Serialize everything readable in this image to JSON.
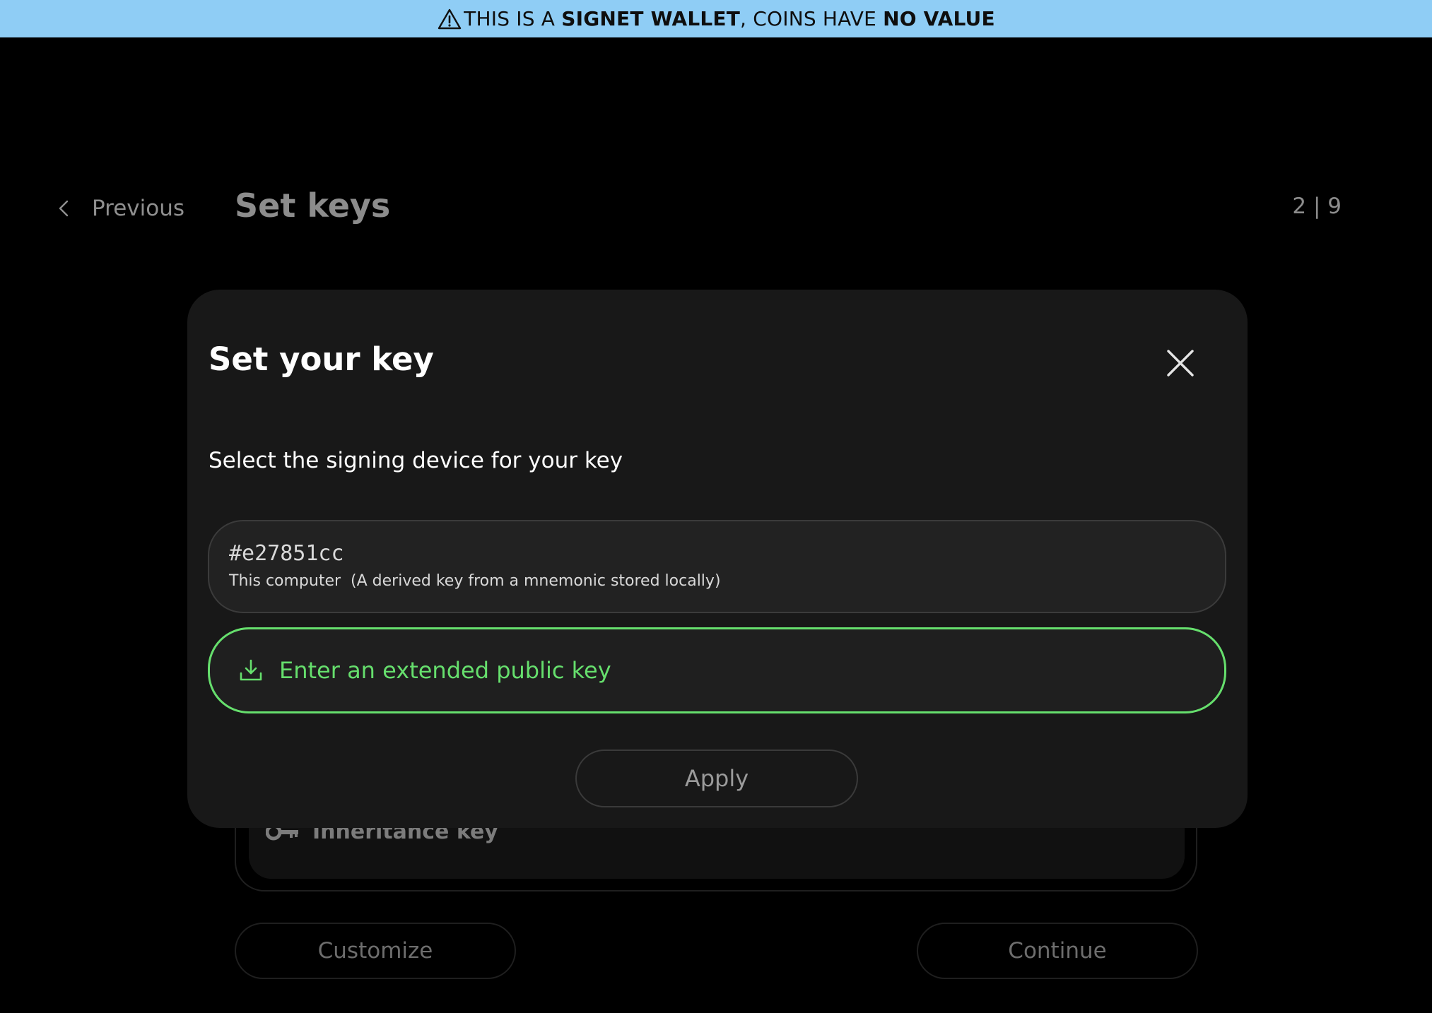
{
  "banner": {
    "prefix": "THIS IS A ",
    "wallet_type": "SIGNET WALLET",
    "middle": ", COINS HAVE ",
    "value_text": "NO VALUE",
    "icon": "warning-triangle-icon",
    "background_color": "#8fcdf5"
  },
  "header": {
    "previous_label": "Previous",
    "title": "Set keys",
    "step": "2 | 9"
  },
  "background": {
    "inheritance_key_label": "Inheritance key",
    "customize_label": "Customize",
    "continue_label": "Continue"
  },
  "modal": {
    "title": "Set your key",
    "subtitle": "Select the signing device for your key",
    "device": {
      "fingerprint": "#e27851cc",
      "description": "This computer  (A derived key from a mnemonic stored locally)"
    },
    "xpub_button_label": "Enter an extended public key",
    "apply_label": "Apply",
    "accent_color": "#66df6d"
  }
}
